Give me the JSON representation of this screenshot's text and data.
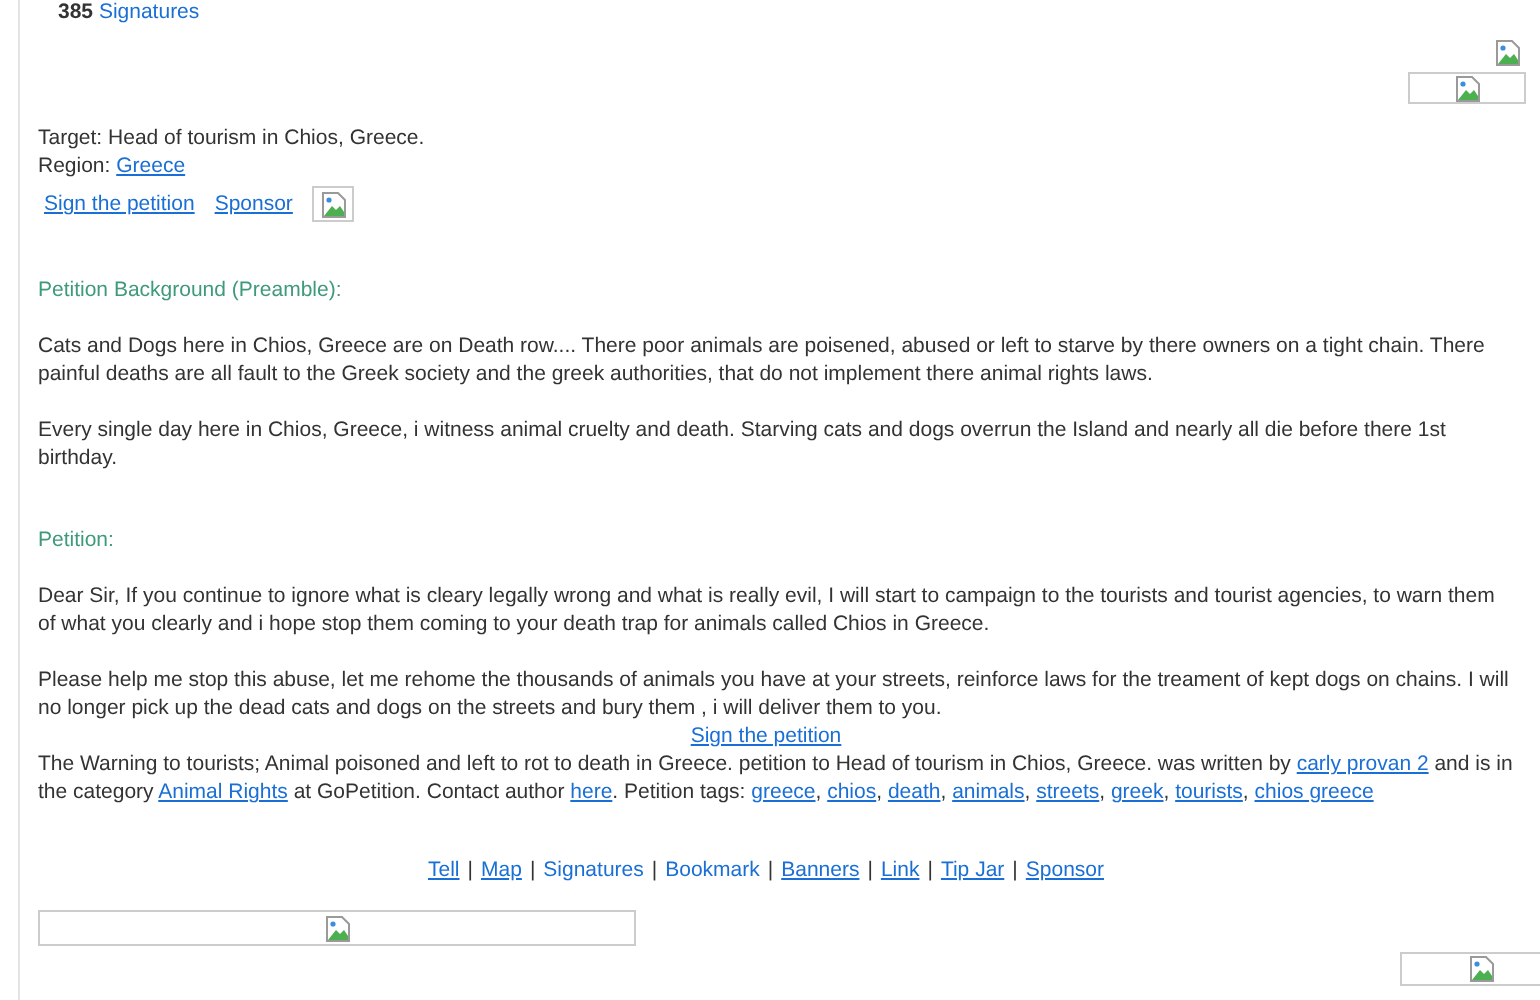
{
  "signatures": {
    "count": "385",
    "label": "Signatures"
  },
  "target": {
    "label": "Target:",
    "value": "Head of tourism in Chios, Greece."
  },
  "region": {
    "label": "Region:",
    "value": "Greece"
  },
  "actions": [
    "Sign the petition",
    "Sponsor"
  ],
  "background": {
    "heading": "Petition Background (Preamble):",
    "paragraphs": [
      "Cats and Dogs here in Chios, Greece are on Death row.... There poor animals are poisened, abused or left to starve by there owners on a tight chain. There painful deaths are all fault to the Greek society and the greek authorities, that do not implement there animal rights laws.",
      "Every single day here in Chios, Greece, i witness animal cruelty and death. Starving cats and dogs overrun the Island and nearly all die before there 1st birthday."
    ]
  },
  "petition": {
    "heading": "Petition:",
    "paragraphs": [
      "Dear Sir, If you continue to ignore what is cleary legally wrong and what is really evil, I will start to campaign to the tourists and tourist agencies, to warn them of what you clearly and i hope stop them coming to your death trap for animals called Chios in Greece.",
      "Please help me stop this abuse, let me rehome the thousands of animals you have at your streets, reinforce laws for the treament of kept dogs on chains. I will no longer pick up the dead cats and dogs on the streets and bury them , i will deliver them to you."
    ]
  },
  "sign_link": "Sign the petition",
  "summary": [
    {
      "kind": "text",
      "text": "The Warning to tourists; Animal poisoned and left to rot to death in Greece. petition to Head of tourism in Chios, Greece. was written by "
    },
    {
      "kind": "link",
      "text": "carly provan 2"
    },
    {
      "kind": "text",
      "text": " and is in the category "
    },
    {
      "kind": "link",
      "text": "Animal Rights"
    },
    {
      "kind": "text",
      "text": " at GoPetition. Contact author "
    },
    {
      "kind": "link",
      "text": "here"
    },
    {
      "kind": "text",
      "text": ". Petition tags: "
    },
    {
      "kind": "link",
      "text": "greece"
    },
    {
      "kind": "text",
      "text": ", "
    },
    {
      "kind": "link",
      "text": "chios"
    },
    {
      "kind": "text",
      "text": ", "
    },
    {
      "kind": "link",
      "text": "death"
    },
    {
      "kind": "text",
      "text": ", "
    },
    {
      "kind": "link",
      "text": "animals"
    },
    {
      "kind": "text",
      "text": ", "
    },
    {
      "kind": "link",
      "text": "streets"
    },
    {
      "kind": "text",
      "text": ", "
    },
    {
      "kind": "link",
      "text": "greek"
    },
    {
      "kind": "text",
      "text": ", "
    },
    {
      "kind": "link",
      "text": "tourists"
    },
    {
      "kind": "text",
      "text": ", "
    },
    {
      "kind": "link",
      "text": "chios greece"
    }
  ],
  "footer_links": [
    {
      "label": "Tell",
      "underlined": true
    },
    {
      "label": "Map",
      "underlined": true
    },
    {
      "label": "Signatures",
      "underlined": false
    },
    {
      "label": "Bookmark",
      "underlined": false
    },
    {
      "label": "Banners",
      "underlined": true
    },
    {
      "label": "Link",
      "underlined": true
    },
    {
      "label": "Tip Jar",
      "underlined": true
    },
    {
      "label": "Sponsor",
      "underlined": true
    }
  ],
  "footer_separator": "|"
}
